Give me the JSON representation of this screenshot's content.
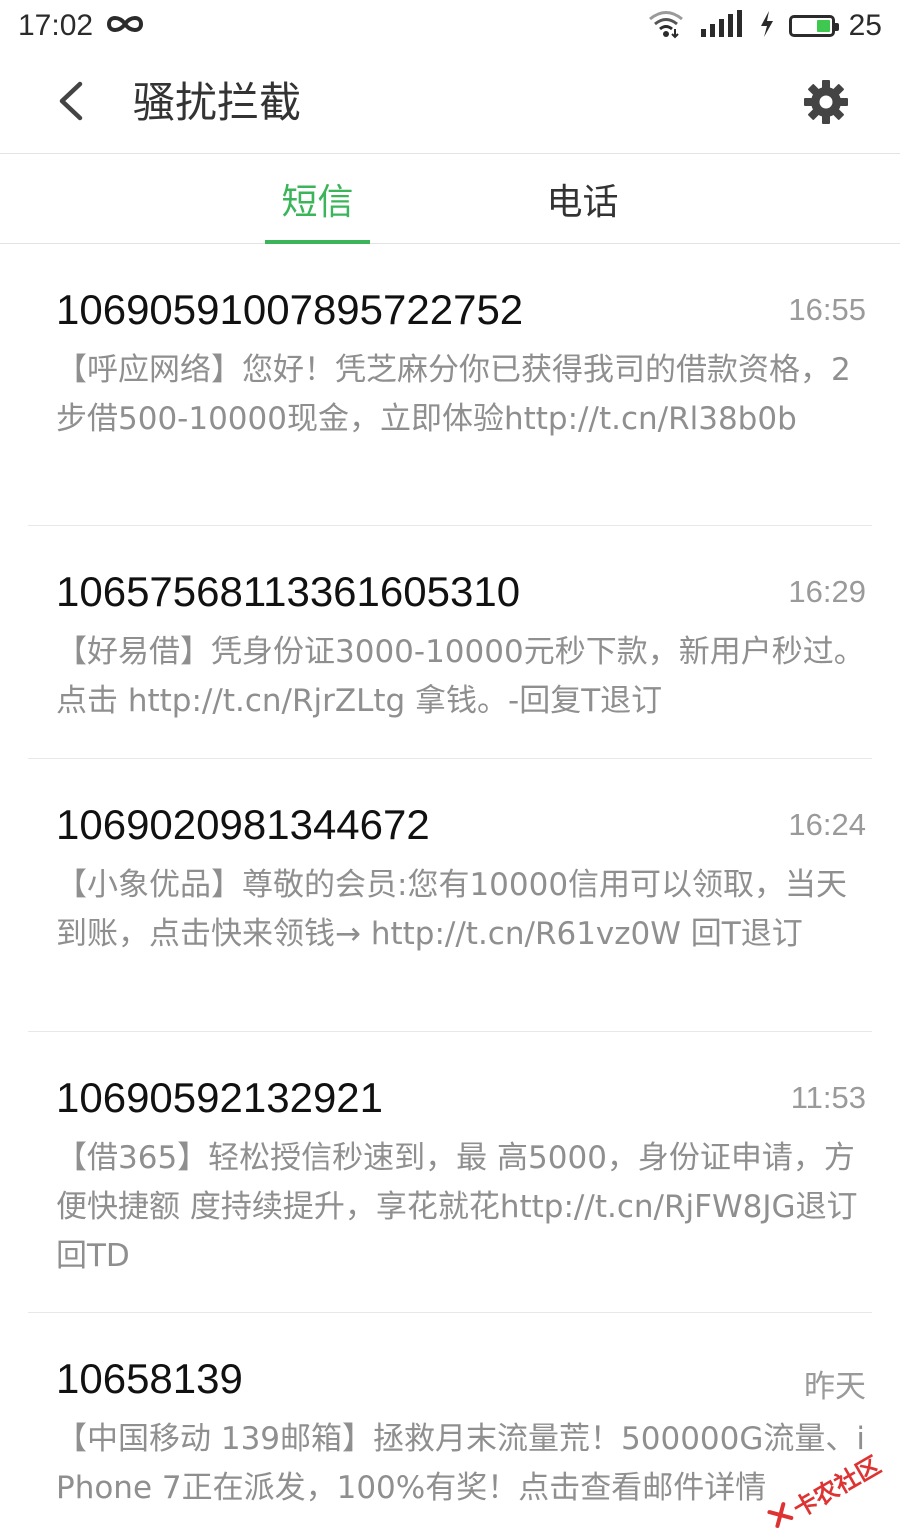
{
  "status_bar": {
    "time": "17:02",
    "battery_percent": "25",
    "battery_level": 0.35,
    "icons": [
      "infinity-icon",
      "wifi-icon",
      "signal-icon",
      "charging-icon",
      "battery-icon"
    ]
  },
  "header": {
    "title": "骚扰拦截",
    "back_icon": "chevron-left-icon",
    "settings_icon": "gear-icon"
  },
  "tabs": [
    {
      "label": "短信",
      "active": true
    },
    {
      "label": "电话",
      "active": false
    }
  ],
  "colors": {
    "accent": "#3cb45a",
    "time_text": "#9a9a9a",
    "body_text": "#8f8f8f"
  },
  "messages": [
    {
      "sender": "1069059100789572275​2",
      "time": "16:55",
      "body": "【呼应网络】您好！凭芝麻分你已获得我司的借款资格，2步借500-10000现金，立即体验http://t.cn/Rl38b0b"
    },
    {
      "sender": "1065756811336160531​0",
      "time": "16:29",
      "body": "【好易借】凭身份证3000-10000元秒下款，新用户秒过。点击 http://t.cn/RjrZLtg 拿钱。-回复T退订"
    },
    {
      "sender": "1069020981344672",
      "time": "16:24",
      "body": "【小象优品】尊敬的会员:您有10000信用可以领取，当天到账，点击快来领钱→ http://t.cn/R61vz0W 回T退订"
    },
    {
      "sender": "10690592132921",
      "time": "11:53",
      "body": "【借365】轻松授信秒速到，最 高5000，身份证申请，方便快捷额 度持续提升，享花就花http://t.cn/RjFW8JG退订回TD"
    },
    {
      "sender": "10658139",
      "time": "昨天",
      "body": "【中国移动 139邮箱】拯救月末流量荒！500000G流量、iPhone 7正在派发，100%有奖！点击查看邮件详情"
    }
  ],
  "watermark": {
    "text": "卡农社区"
  }
}
